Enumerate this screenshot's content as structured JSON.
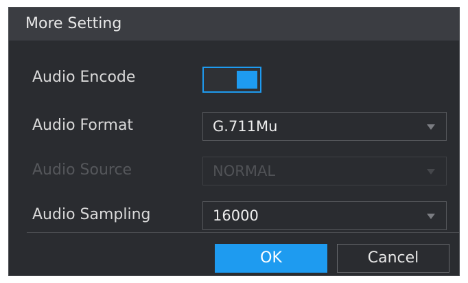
{
  "dialog": {
    "title": "More Setting"
  },
  "fields": {
    "audio_encode": {
      "label": "Audio Encode",
      "enabled": true
    },
    "audio_format": {
      "label": "Audio Format",
      "value": "G.711Mu"
    },
    "audio_source": {
      "label": "Audio Source",
      "value": "NORMAL",
      "disabled": true
    },
    "audio_sampling": {
      "label": "Audio Sampling",
      "value": "16000"
    }
  },
  "buttons": {
    "ok_label": "OK",
    "cancel_label": "Cancel"
  },
  "colors": {
    "accent": "#1e9bf0",
    "background": "#2a2c30",
    "titlebar": "#3b3d42"
  }
}
